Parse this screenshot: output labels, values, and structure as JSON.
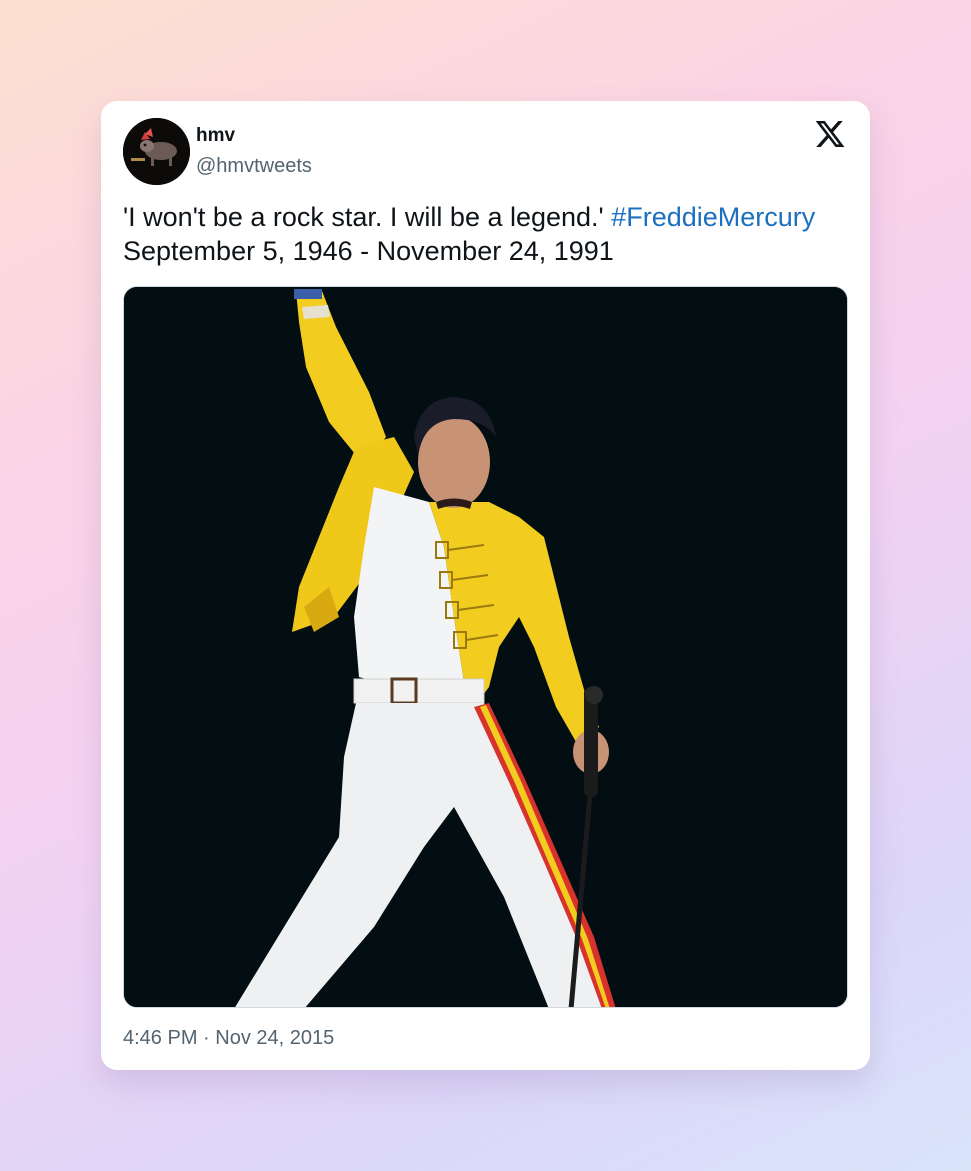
{
  "tweet": {
    "author": {
      "display_name": "hmv",
      "handle": "@hmvtweets",
      "avatar_icon": "hmv-dog-logo-icon"
    },
    "text_part1": "'I won't be a rock star. I will be a legend.'",
    "hashtag": "#FreddieMercury",
    "text_line2": "September 5, 1946 - November 24, 1991",
    "timestamp": "4:46 PM · Nov 24, 2015",
    "media_icon": "performer-photo",
    "platform_icon": "x-logo-icon"
  },
  "colors": {
    "background_start": "#fde0d0",
    "background_end": "#d9e4fb",
    "card": "#ffffff",
    "text": "#0f1419",
    "secondary_text": "#536471",
    "link": "#1d6fbf",
    "photo_background": "#030e12"
  }
}
